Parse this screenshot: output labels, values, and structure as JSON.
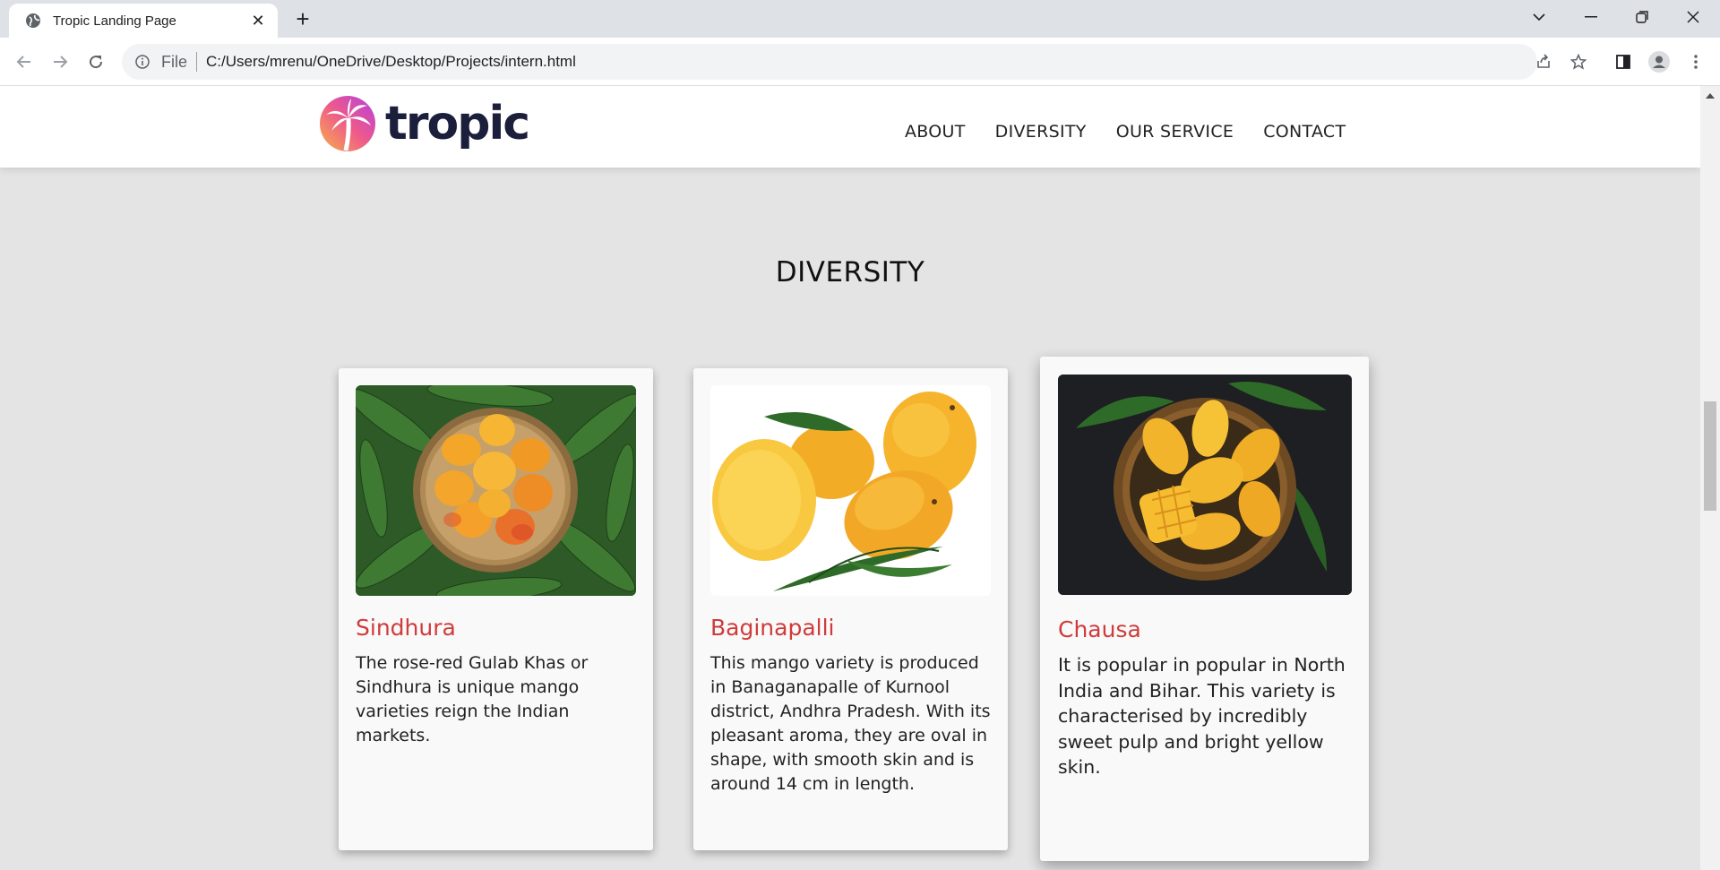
{
  "browser": {
    "tab_title": "Tropic Landing Page",
    "address_prefix": "File",
    "url": "C:/Users/mrenu/OneDrive/Desktop/Projects/intern.html"
  },
  "site": {
    "logo_text": "tropic",
    "nav": [
      "ABOUT",
      "DIVERSITY",
      "OUR SERVICE",
      "CONTACT"
    ],
    "section_title": "DIVERSITY"
  },
  "cards": [
    {
      "title": "Sindhura",
      "text": "The rose-red Gulab Khas or Sindhura is unique mango varieties reign the Indian markets."
    },
    {
      "title": "Baginapalli",
      "text": "This mango variety is produced in Banaganapalle of Kurnool district, Andhra Pradesh. With its pleasant aroma, they are oval in shape, with smooth skin and is around 14 cm in length."
    },
    {
      "title": "Chausa",
      "text": "It is popular in popular in North India and Bihar. This variety is characterised by incredibly sweet pulp and bright yellow skin."
    }
  ],
  "colors": {
    "accent_title": "#d03b3b",
    "logo_gradient_start": "#f39a4a",
    "logo_gradient_end": "#c63fd8",
    "page_bg": "#e4e4e4"
  }
}
